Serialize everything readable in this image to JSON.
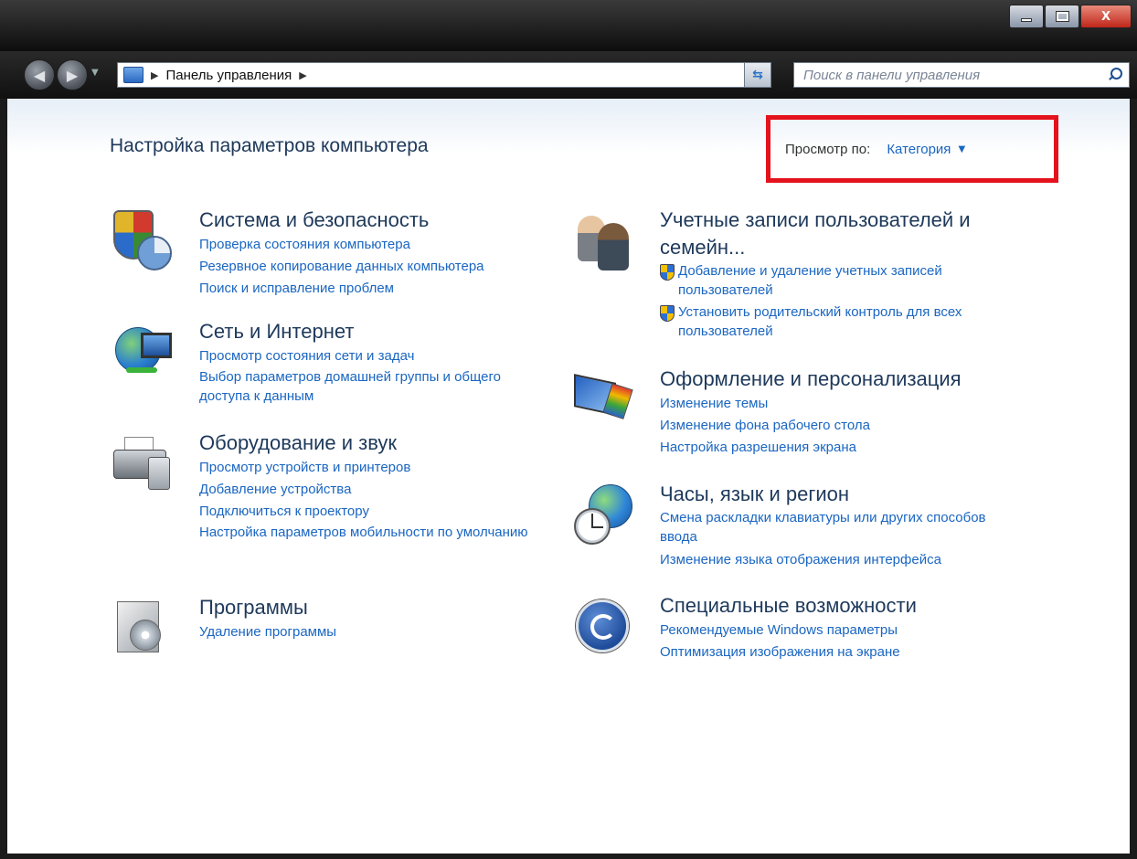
{
  "window": {
    "controls": {
      "minimize": "",
      "maximize": "",
      "close": "X"
    }
  },
  "nav": {
    "address": {
      "icon": "control-panel-icon",
      "path": "Панель управления"
    },
    "search": {
      "placeholder": "Поиск в панели управления"
    }
  },
  "main": {
    "title": "Настройка параметров компьютера",
    "view_by": {
      "label": "Просмотр по:",
      "value": "Категория"
    }
  },
  "categories_left": [
    {
      "icon": "shield-chart-icon",
      "title": "Система и безопасность",
      "links": [
        "Проверка состояния компьютера",
        "Резервное копирование данных компьютера",
        "Поиск и исправление проблем"
      ]
    },
    {
      "icon": "network-globe-icon",
      "title": "Сеть и Интернет",
      "links": [
        "Просмотр состояния сети и задач",
        "Выбор параметров домашней группы и общего доступа к данным"
      ]
    },
    {
      "icon": "printer-speaker-icon",
      "title": "Оборудование и звук",
      "links": [
        "Просмотр устройств и принтеров",
        "Добавление устройства",
        "Подключиться к проектору",
        "Настройка параметров мобильности по умолчанию"
      ]
    },
    {
      "icon": "programs-box-icon",
      "title": "Программы",
      "links": [
        "Удаление программы"
      ]
    }
  ],
  "categories_right": [
    {
      "icon": "users-icon",
      "title": "Учетные записи пользователей и семейн...",
      "links": [
        "Добавление и удаление учетных записей пользователей",
        "Установить родительский контроль для всех пользователей"
      ]
    },
    {
      "icon": "personalization-icon",
      "title": "Оформление и персонализация",
      "links": [
        "Изменение темы",
        "Изменение фона рабочего стола",
        "Настройка разрешения экрана"
      ]
    },
    {
      "icon": "globe-clock-icon",
      "title": "Часы, язык и регион",
      "links": [
        "Смена раскладки клавиатуры или других способов ввода",
        "Изменение языка отображения интерфейса"
      ]
    },
    {
      "icon": "accessibility-icon",
      "title": "Специальные возможности",
      "links": [
        "Рекомендуемые Windows параметры",
        "Оптимизация изображения на экране"
      ]
    }
  ]
}
